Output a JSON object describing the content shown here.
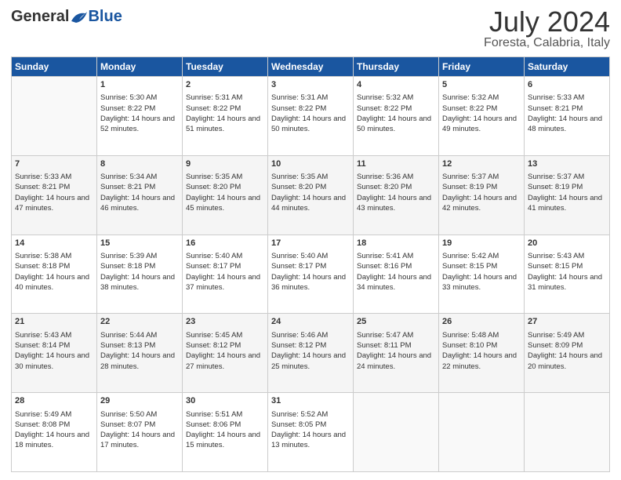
{
  "header": {
    "logo_general": "General",
    "logo_blue": "Blue",
    "month": "July 2024",
    "location": "Foresta, Calabria, Italy"
  },
  "days": [
    "Sunday",
    "Monday",
    "Tuesday",
    "Wednesday",
    "Thursday",
    "Friday",
    "Saturday"
  ],
  "weeks": [
    [
      {
        "num": "",
        "sunrise": "",
        "sunset": "",
        "daylight": ""
      },
      {
        "num": "1",
        "sunrise": "Sunrise: 5:30 AM",
        "sunset": "Sunset: 8:22 PM",
        "daylight": "Daylight: 14 hours and 52 minutes."
      },
      {
        "num": "2",
        "sunrise": "Sunrise: 5:31 AM",
        "sunset": "Sunset: 8:22 PM",
        "daylight": "Daylight: 14 hours and 51 minutes."
      },
      {
        "num": "3",
        "sunrise": "Sunrise: 5:31 AM",
        "sunset": "Sunset: 8:22 PM",
        "daylight": "Daylight: 14 hours and 50 minutes."
      },
      {
        "num": "4",
        "sunrise": "Sunrise: 5:32 AM",
        "sunset": "Sunset: 8:22 PM",
        "daylight": "Daylight: 14 hours and 50 minutes."
      },
      {
        "num": "5",
        "sunrise": "Sunrise: 5:32 AM",
        "sunset": "Sunset: 8:22 PM",
        "daylight": "Daylight: 14 hours and 49 minutes."
      },
      {
        "num": "6",
        "sunrise": "Sunrise: 5:33 AM",
        "sunset": "Sunset: 8:21 PM",
        "daylight": "Daylight: 14 hours and 48 minutes."
      }
    ],
    [
      {
        "num": "7",
        "sunrise": "Sunrise: 5:33 AM",
        "sunset": "Sunset: 8:21 PM",
        "daylight": "Daylight: 14 hours and 47 minutes."
      },
      {
        "num": "8",
        "sunrise": "Sunrise: 5:34 AM",
        "sunset": "Sunset: 8:21 PM",
        "daylight": "Daylight: 14 hours and 46 minutes."
      },
      {
        "num": "9",
        "sunrise": "Sunrise: 5:35 AM",
        "sunset": "Sunset: 8:20 PM",
        "daylight": "Daylight: 14 hours and 45 minutes."
      },
      {
        "num": "10",
        "sunrise": "Sunrise: 5:35 AM",
        "sunset": "Sunset: 8:20 PM",
        "daylight": "Daylight: 14 hours and 44 minutes."
      },
      {
        "num": "11",
        "sunrise": "Sunrise: 5:36 AM",
        "sunset": "Sunset: 8:20 PM",
        "daylight": "Daylight: 14 hours and 43 minutes."
      },
      {
        "num": "12",
        "sunrise": "Sunrise: 5:37 AM",
        "sunset": "Sunset: 8:19 PM",
        "daylight": "Daylight: 14 hours and 42 minutes."
      },
      {
        "num": "13",
        "sunrise": "Sunrise: 5:37 AM",
        "sunset": "Sunset: 8:19 PM",
        "daylight": "Daylight: 14 hours and 41 minutes."
      }
    ],
    [
      {
        "num": "14",
        "sunrise": "Sunrise: 5:38 AM",
        "sunset": "Sunset: 8:18 PM",
        "daylight": "Daylight: 14 hours and 40 minutes."
      },
      {
        "num": "15",
        "sunrise": "Sunrise: 5:39 AM",
        "sunset": "Sunset: 8:18 PM",
        "daylight": "Daylight: 14 hours and 38 minutes."
      },
      {
        "num": "16",
        "sunrise": "Sunrise: 5:40 AM",
        "sunset": "Sunset: 8:17 PM",
        "daylight": "Daylight: 14 hours and 37 minutes."
      },
      {
        "num": "17",
        "sunrise": "Sunrise: 5:40 AM",
        "sunset": "Sunset: 8:17 PM",
        "daylight": "Daylight: 14 hours and 36 minutes."
      },
      {
        "num": "18",
        "sunrise": "Sunrise: 5:41 AM",
        "sunset": "Sunset: 8:16 PM",
        "daylight": "Daylight: 14 hours and 34 minutes."
      },
      {
        "num": "19",
        "sunrise": "Sunrise: 5:42 AM",
        "sunset": "Sunset: 8:15 PM",
        "daylight": "Daylight: 14 hours and 33 minutes."
      },
      {
        "num": "20",
        "sunrise": "Sunrise: 5:43 AM",
        "sunset": "Sunset: 8:15 PM",
        "daylight": "Daylight: 14 hours and 31 minutes."
      }
    ],
    [
      {
        "num": "21",
        "sunrise": "Sunrise: 5:43 AM",
        "sunset": "Sunset: 8:14 PM",
        "daylight": "Daylight: 14 hours and 30 minutes."
      },
      {
        "num": "22",
        "sunrise": "Sunrise: 5:44 AM",
        "sunset": "Sunset: 8:13 PM",
        "daylight": "Daylight: 14 hours and 28 minutes."
      },
      {
        "num": "23",
        "sunrise": "Sunrise: 5:45 AM",
        "sunset": "Sunset: 8:12 PM",
        "daylight": "Daylight: 14 hours and 27 minutes."
      },
      {
        "num": "24",
        "sunrise": "Sunrise: 5:46 AM",
        "sunset": "Sunset: 8:12 PM",
        "daylight": "Daylight: 14 hours and 25 minutes."
      },
      {
        "num": "25",
        "sunrise": "Sunrise: 5:47 AM",
        "sunset": "Sunset: 8:11 PM",
        "daylight": "Daylight: 14 hours and 24 minutes."
      },
      {
        "num": "26",
        "sunrise": "Sunrise: 5:48 AM",
        "sunset": "Sunset: 8:10 PM",
        "daylight": "Daylight: 14 hours and 22 minutes."
      },
      {
        "num": "27",
        "sunrise": "Sunrise: 5:49 AM",
        "sunset": "Sunset: 8:09 PM",
        "daylight": "Daylight: 14 hours and 20 minutes."
      }
    ],
    [
      {
        "num": "28",
        "sunrise": "Sunrise: 5:49 AM",
        "sunset": "Sunset: 8:08 PM",
        "daylight": "Daylight: 14 hours and 18 minutes."
      },
      {
        "num": "29",
        "sunrise": "Sunrise: 5:50 AM",
        "sunset": "Sunset: 8:07 PM",
        "daylight": "Daylight: 14 hours and 17 minutes."
      },
      {
        "num": "30",
        "sunrise": "Sunrise: 5:51 AM",
        "sunset": "Sunset: 8:06 PM",
        "daylight": "Daylight: 14 hours and 15 minutes."
      },
      {
        "num": "31",
        "sunrise": "Sunrise: 5:52 AM",
        "sunset": "Sunset: 8:05 PM",
        "daylight": "Daylight: 14 hours and 13 minutes."
      },
      {
        "num": "",
        "sunrise": "",
        "sunset": "",
        "daylight": ""
      },
      {
        "num": "",
        "sunrise": "",
        "sunset": "",
        "daylight": ""
      },
      {
        "num": "",
        "sunrise": "",
        "sunset": "",
        "daylight": ""
      }
    ]
  ]
}
